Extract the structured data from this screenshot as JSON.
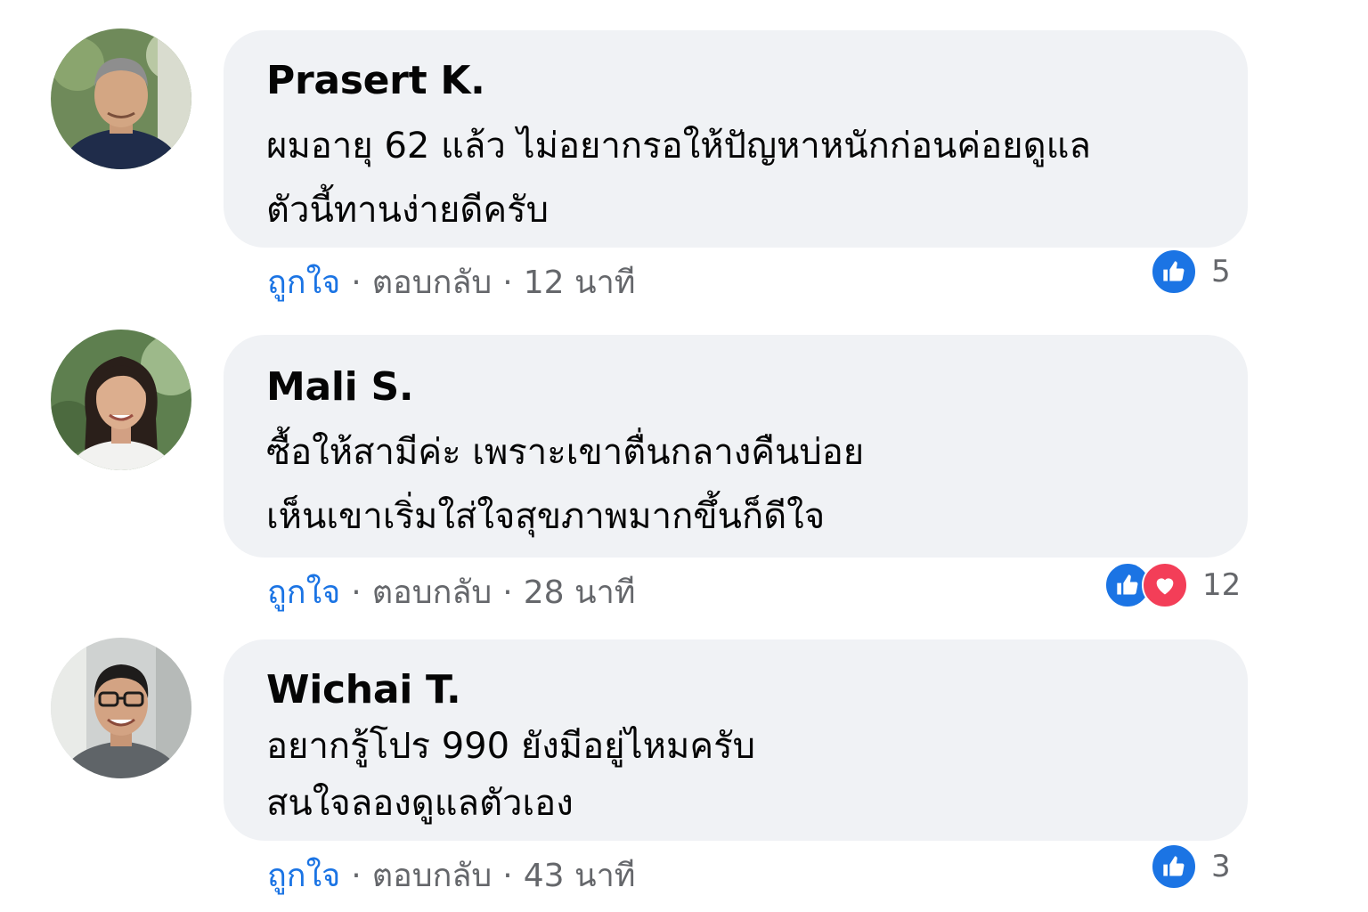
{
  "comments": [
    {
      "author": "Prasert K.",
      "line1": "ผมอายุ 62 แล้ว ไม่อยากรอให้ปัญหาหนักก่อนค่อยดูแล",
      "line2": "ตัวนี้ทานง่ายดีครับ",
      "like_label": "ถูกใจ",
      "reply_label": "ตอบกลับ",
      "time": "12 นาที",
      "reactions": [
        "like"
      ],
      "reaction_count": "5"
    },
    {
      "author": "Mali S.",
      "line1": "ซื้อให้สามีค่ะ เพราะเขาตื่นกลางคืนบ่อย",
      "line2": "เห็นเขาเริ่มใส่ใจสุขภาพมากขึ้นก็ดีใจ",
      "like_label": "ถูกใจ",
      "reply_label": "ตอบกลับ",
      "time": "28 นาที",
      "reactions": [
        "like",
        "love"
      ],
      "reaction_count": "12"
    },
    {
      "author": "Wichai T.",
      "line1": "อยากรู้โปร 990 ยังมีอยู่ไหมครับ",
      "line2": "สนใจลองดูแลตัวเอง",
      "like_label": "ถูกใจ",
      "reply_label": "ตอบกลับ",
      "time": "43 นาที",
      "reactions": [
        "like"
      ],
      "reaction_count": "3"
    }
  ],
  "colors": {
    "bubble": "#f0f2f5",
    "like_text": "#1b74e4",
    "meta_text": "#65676b",
    "like_reaction": "#1b74e4",
    "love_reaction": "#f33e58"
  },
  "icons": {
    "like": "thumbs-up-icon",
    "love": "heart-icon"
  }
}
